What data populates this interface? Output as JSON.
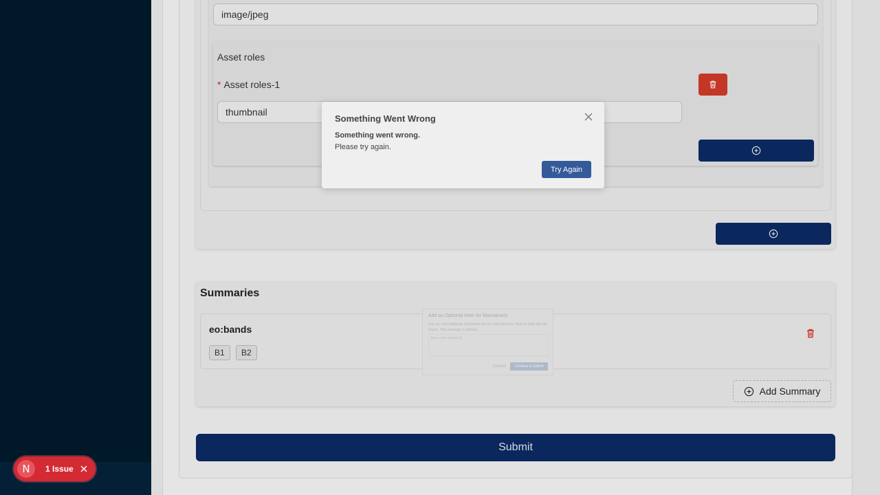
{
  "form": {
    "mime_type_value": "image/jpeg",
    "asset_roles_title": "Asset roles",
    "asset_role_label": "Asset roles-1",
    "asset_role_required_mark": "*",
    "asset_role_value": "thumbnail"
  },
  "summaries": {
    "title": "Summaries",
    "items": [
      {
        "key": "eo:bands",
        "values": [
          "B1",
          "B2"
        ]
      }
    ],
    "add_label": "Add Summary"
  },
  "submit_label": "Submit",
  "ghost_modal": {
    "title": "Add an Optional Note for Maintainers",
    "text": "You can add additional information for the Data Services Team to help with the import. This message is optional.",
    "placeholder": "Add a note (optional)",
    "cancel": "Cancel",
    "continue": "Continue & Submit"
  },
  "error_modal": {
    "title": "Something Went Wrong",
    "message_bold": "Something went wrong.",
    "message": "Please try again.",
    "button": "Try Again"
  },
  "issues_badge": {
    "logo": "N",
    "text": "1 Issue"
  },
  "colors": {
    "sidebar": "#021a2c",
    "primary": "#0b2a66",
    "danger": "#d33c2a",
    "badge": "#d42a34"
  },
  "icons": [
    "trash-icon",
    "plus-circle-icon",
    "close-icon"
  ]
}
